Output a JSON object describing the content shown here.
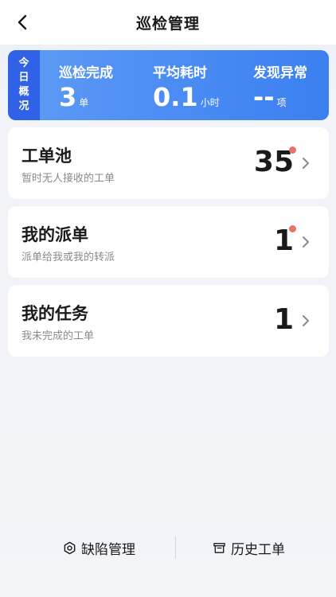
{
  "nav": {
    "title": "巡检管理"
  },
  "summary": {
    "tag": [
      "今",
      "日",
      "概",
      "况"
    ],
    "stats": [
      {
        "label": "巡检完成",
        "value": "3",
        "unit": "单"
      },
      {
        "label": "平均耗时",
        "value": "0.1",
        "unit": "小时"
      },
      {
        "label": "发现异常",
        "value": "--",
        "unit": "项"
      }
    ]
  },
  "cards": [
    {
      "title": "工单池",
      "subtitle": "暂时无人接收的工单",
      "count": "35",
      "has_dot": true
    },
    {
      "title": "我的派单",
      "subtitle": "派单给我或我的转派",
      "count": "1",
      "has_dot": true
    },
    {
      "title": "我的任务",
      "subtitle": "我未完成的工单",
      "count": "1",
      "has_dot": false
    }
  ],
  "bottom": {
    "defect_label": "缺陷管理",
    "history_label": "历史工单"
  },
  "colors": {
    "accent_blue": "#3b7ff0",
    "tag_blue": "#2f62e6",
    "dot_red": "#e8736a"
  }
}
